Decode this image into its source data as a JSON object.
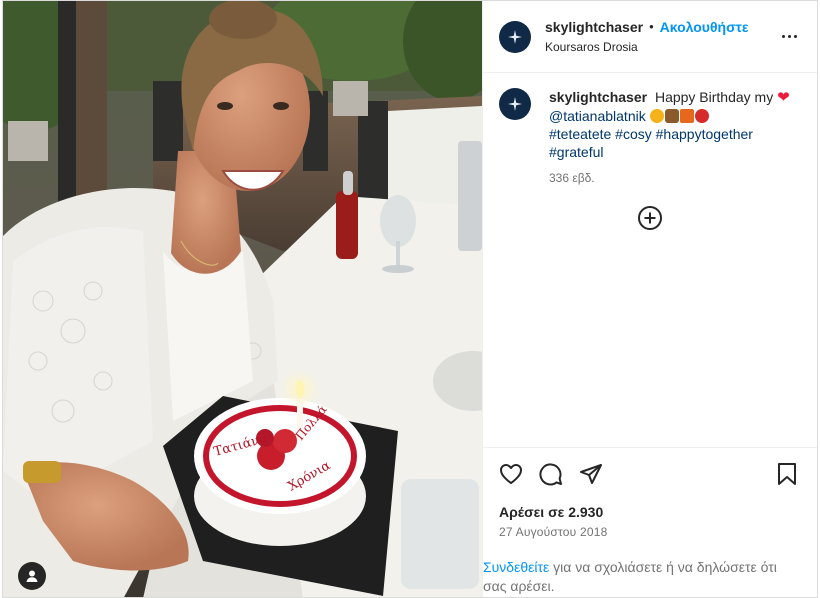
{
  "post": {
    "author": {
      "username": "skylightchaser",
      "separator": "•",
      "follow_label": "Ακολουθήστε",
      "location": "Koursaros Drosia",
      "avatar_color": "#0f2946"
    },
    "caption": {
      "username": "skylightchaser",
      "text_before": "Happy Birthday my",
      "heart": "❤",
      "mention": "@tatianablatnik",
      "hashtags": [
        "#teteatete",
        "#cosy",
        "#happytogether",
        "#grateful"
      ],
      "time_ago": "336 εβδ."
    },
    "icons": {
      "like": "heart-icon",
      "comment": "comment-icon",
      "share": "share-icon",
      "save": "bookmark-icon",
      "more": "more-options-icon",
      "load_more": "plus-circle-icon",
      "user_tag": "user-tag-icon"
    },
    "likes_text": "Αρέσει σε 2.930",
    "date_text": "27 Αυγούστου 2018",
    "login_prompt": {
      "link": "Συνδεθείτε",
      "text": " για να σχολιάσετε ή να δηλώσετε ότι σας αρέσει."
    },
    "cake_text": {
      "line1": "Τατιάνα",
      "line2": "Χρόνια",
      "line3": "Πολλά"
    },
    "colors": {
      "accent": "#0095f6",
      "hashtag": "#00376b",
      "heart": "#ed1c3b"
    }
  }
}
